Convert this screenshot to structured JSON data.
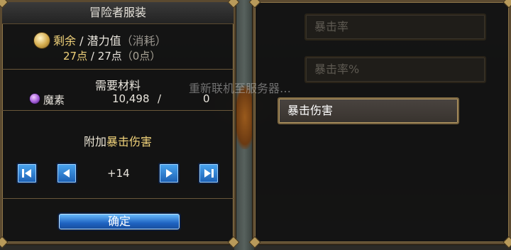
{
  "left_panel": {
    "title": "冒险者服装",
    "points": {
      "label_remaining": "剩余",
      "separator": " / ",
      "label_potential": "潜力值",
      "label_consumed": "（消耗）",
      "remaining_value": "27点",
      "slash": " / ",
      "potential_value": "27点",
      "consumed_value": "（0点）"
    },
    "materials": {
      "header": "需要材料",
      "item_name": "魔素",
      "owned": "10,498",
      "slash": "/",
      "required": "0"
    },
    "attribute": {
      "prefix": "附加",
      "name": "暴击伤害"
    },
    "stepper": {
      "value": "+14",
      "first_icon": "skip-first-icon",
      "prev_icon": "prev-arrow-icon",
      "next_icon": "next-arrow-icon",
      "last_icon": "skip-last-icon"
    },
    "confirm_label": "确定"
  },
  "right_panel": {
    "options": [
      {
        "label": "暴击率",
        "state": "disabled"
      },
      {
        "label": "暴击率%",
        "state": "disabled"
      },
      {
        "label": "暴击伤害",
        "state": "selected"
      }
    ]
  },
  "overlay": {
    "reconnect_message": "重新联机至服务器…"
  },
  "colors": {
    "gold_text": "#f0d27a",
    "frame_gold": "#8d7548",
    "button_blue": "#1f63c2",
    "panel_bg": "#121212"
  }
}
